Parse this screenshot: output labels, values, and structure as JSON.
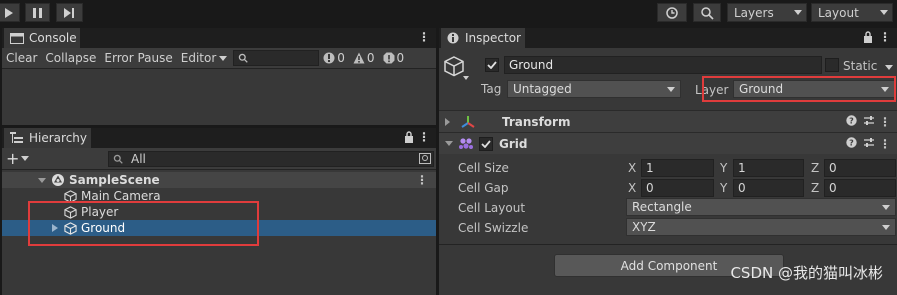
{
  "toolbar": {
    "history_icon": "history-icon",
    "search_icon": "search-icon",
    "layers_label": "Layers",
    "layout_label": "Layout"
  },
  "console": {
    "tab_label": "Console",
    "clear": "Clear",
    "collapse": "Collapse",
    "error_pause": "Error Pause",
    "editor": "Editor",
    "info_count": "0",
    "warn_count": "0",
    "error_count": "0"
  },
  "hierarchy": {
    "tab_label": "Hierarchy",
    "search_placeholder": "All",
    "scene": "SampleScene",
    "items": [
      {
        "label": "Main Camera"
      },
      {
        "label": "Player"
      },
      {
        "label": "Ground"
      }
    ]
  },
  "inspector": {
    "tab_label": "Inspector",
    "object_name": "Ground",
    "static_label": "Static",
    "tag_label": "Tag",
    "tag_value": "Untagged",
    "layer_label": "Layer",
    "layer_value": "Ground",
    "transform_label": "Transform",
    "grid_label": "Grid",
    "rows": [
      {
        "label": "Cell Size",
        "x": "1",
        "y": "1",
        "z": "0"
      },
      {
        "label": "Cell Gap",
        "x": "0",
        "y": "0",
        "z": "0"
      }
    ],
    "cell_layout_label": "Cell Layout",
    "cell_layout_value": "Rectangle",
    "cell_swizzle_label": "Cell Swizzle",
    "cell_swizzle_value": "XYZ",
    "add_component": "Add Component",
    "axis_x": "X",
    "axis_y": "Y",
    "axis_z": "Z"
  },
  "watermark": "CSDN @我的猫叫冰彬"
}
